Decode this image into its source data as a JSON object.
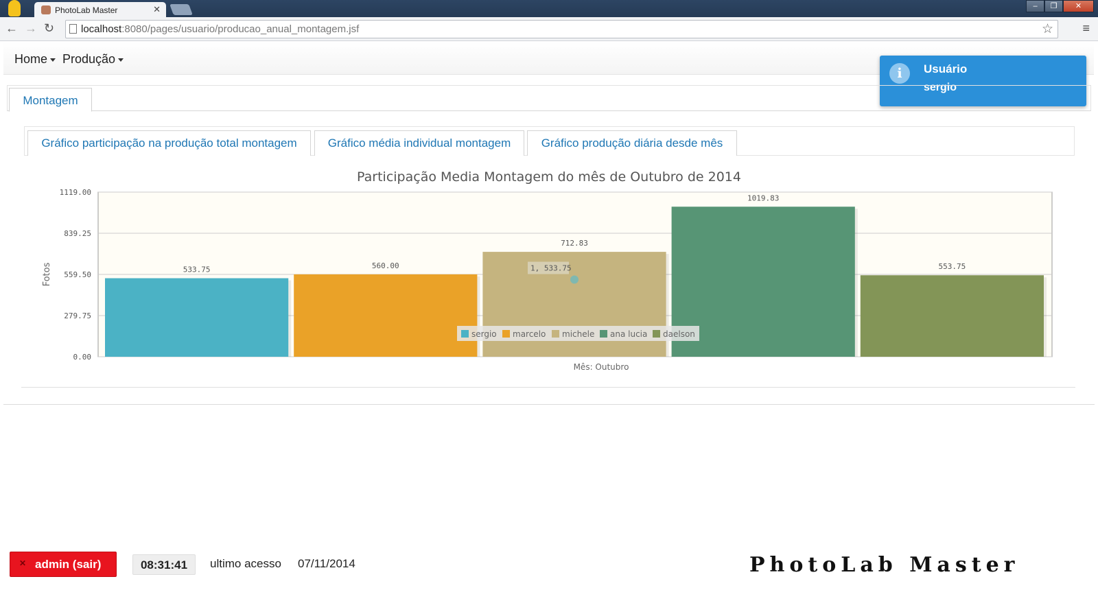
{
  "browser": {
    "tab_title": "PhotoLab Master",
    "url_host": "localhost",
    "url_rest": ":8080/pages/usuario/producao_anual_montagem.jsf"
  },
  "menubar": {
    "items": [
      {
        "label": "Home",
        "icon": "chevron-down-icon"
      },
      {
        "label": "Produção",
        "icon": "chevron-down-icon"
      }
    ]
  },
  "toast": {
    "icon": "info-icon",
    "title": "Usuário",
    "message": "sergio",
    "color": "#2b90d9"
  },
  "outer_tabs": [
    "Montagem"
  ],
  "inner_tabs": [
    "Gráfico participação na produção total montagem",
    "Gráfico média individual montagem",
    "Gráfico produção diária desde mês"
  ],
  "chart_data": {
    "type": "bar",
    "title": "Participação Media Montagem do mês de Outubro de 2014",
    "xlabel": "Mês: Outubro",
    "ylabel": "Fotos",
    "ylim": [
      0,
      1119
    ],
    "yticks": [
      "1119.00",
      "839.25",
      "559.50",
      "279.75",
      "0.00"
    ],
    "grid": true,
    "legend_position": "bottom-center-inside",
    "categories": [
      "Outubro"
    ],
    "series": [
      {
        "name": "sergio",
        "value": 533.75,
        "label": "533.75",
        "color": "#4bb2c5"
      },
      {
        "name": "marcelo",
        "value": 560.0,
        "label": "560.00",
        "color": "#eaa228"
      },
      {
        "name": "michele",
        "value": 712.83,
        "label": "712.83",
        "color": "#c5b47f"
      },
      {
        "name": "ana lucia",
        "value": 1019.83,
        "label": "1019.83",
        "color": "#579575"
      },
      {
        "name": "daelson",
        "value": 553.75,
        "label": "553.75",
        "color": "#839557"
      }
    ],
    "tooltip": "1, 533.75"
  },
  "footer": {
    "logout_label": "admin (sair)",
    "clock": "08:31:41",
    "last_access_label": "ultimo acesso",
    "last_access_date": "07/11/2014",
    "brand": "PhotoLab Master"
  }
}
